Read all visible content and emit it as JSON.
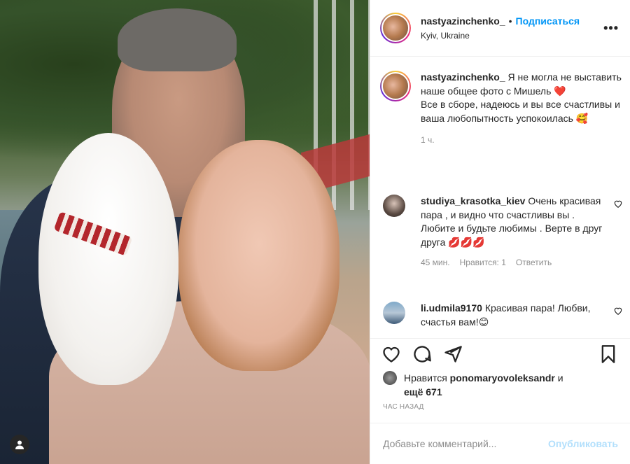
{
  "post": {
    "username": "nastyazinchenko_",
    "follow_label": "Подписаться",
    "location": "Kyiv, Ukraine",
    "more_label": "•••"
  },
  "caption": {
    "username": "nastyazinchenko_",
    "text_line1": " Я не могла не выставить наше общее фото с Мишель ",
    "heart": "❤️",
    "text_line2": "Все в сборе, надеюсь и вы все счастливы и ваша любопытность успокоилась ",
    "emoji": "🥰",
    "time": "1 ч."
  },
  "comments": [
    {
      "username": "studiya_krasotka_kiev",
      "text": " Очень красивая пара , и видно что счастливы вы . Любите и будьте любимы . Верте в друг друга ",
      "emoji": "💋💋💋",
      "time": "45 мин.",
      "likes": "Нравится: 1",
      "reply": "Ответить"
    },
    {
      "username": "li.udmila9170",
      "text": " Красивая пара! Любви, счастья вам!",
      "emoji": "😊"
    }
  ],
  "likes": {
    "prefix": "Нравится ",
    "user": "ponomaryovoleksandr",
    "middle": " и ",
    "count_text": "ещё 671"
  },
  "ago": "ЧАС НАЗАД",
  "add_comment": {
    "placeholder": "Добавьте комментарий...",
    "publish": "Опубликовать"
  },
  "icons": [
    "heart-icon",
    "comment-icon",
    "share-icon",
    "bookmark-icon",
    "user-tag-icon"
  ],
  "colors": {
    "link": "#0095f6",
    "muted": "#8e8e8e",
    "publish_disabled": "#b2dffc",
    "text": "#262626"
  }
}
